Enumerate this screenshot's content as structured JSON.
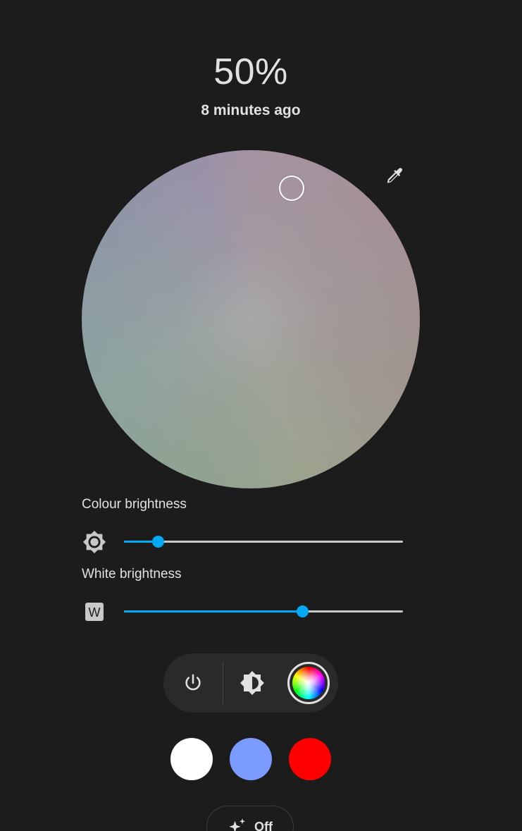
{
  "state": {
    "value": "50%",
    "last_changed": "8 minutes ago"
  },
  "color_picker": {
    "eyedropper_icon": "eyedropper-icon",
    "marker_color": "#ffffff"
  },
  "sliders": {
    "colour_brightness": {
      "label": "Colour brightness",
      "icon": "brightness-icon",
      "value_fraction": 0.12
    },
    "white_brightness": {
      "label": "White brightness",
      "icon": "white-w-icon",
      "icon_text": "W",
      "value_fraction": 0.64
    },
    "accent_color": "#03a9f4"
  },
  "modes": {
    "power_icon": "power-icon",
    "brightness_contrast_icon": "brightness-contrast-icon",
    "color_wheel_icon": "color-wheel-icon",
    "active": "color"
  },
  "favorites": [
    {
      "color": "#ffffff"
    },
    {
      "color": "#7b9bff"
    },
    {
      "color": "#ff0000"
    }
  ],
  "effect": {
    "icon": "sparkles-icon",
    "label": "Off"
  }
}
